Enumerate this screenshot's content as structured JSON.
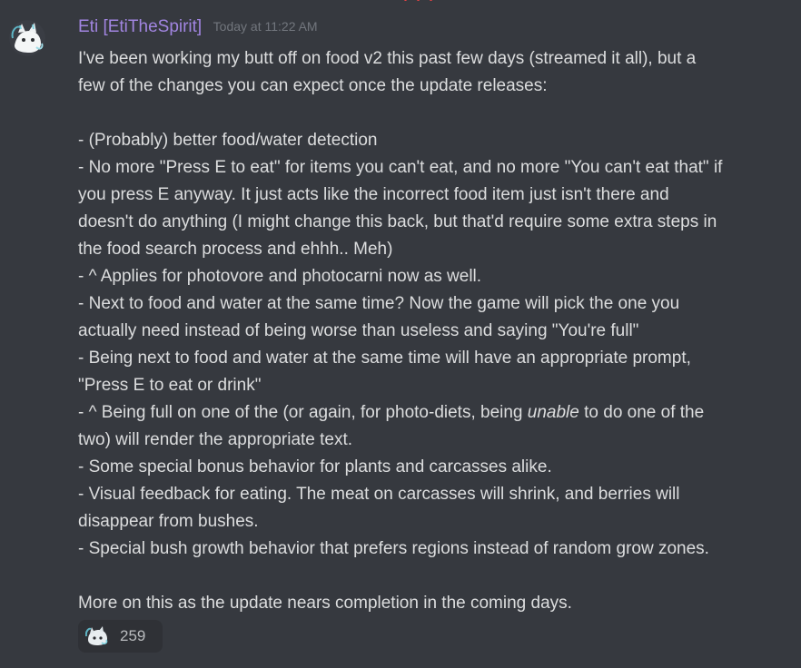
{
  "message": {
    "username": "Eti [EtiTheSpirit]",
    "timestamp": "Today at 11:22 AM",
    "lines": [
      "I've been working my butt off on food v2 this past few days (streamed it all), but a",
      "few of the changes you can expect once the update releases:",
      "",
      "- (Probably) better food/water detection",
      "- No more \"Press E to eat\" for items you can't eat, and no more \"You can't eat that\" if",
      "you press E anyway. It just acts like the incorrect food item just isn't there and",
      "doesn't do anything (I might change this back, but that'd require some extra steps in",
      "the food search process and ehhh.. Meh)",
      "- ^ Applies for photovore and photocarni now as well.",
      "- Next to food and water at the same time? Now the game will pick the one you",
      "actually need instead of being worse than useless and saying \"You're full\"",
      "- Being next to food and water at the same time will have an appropriate prompt,",
      "\"Press E to eat or drink\"",
      "- ^ Being full on one of the (or again, for photo-diets, being ",
      "unable",
      " to do one of the",
      "two) will render the appropriate text.",
      "- Some special bonus behavior for plants and carcasses alike.",
      "- Visual feedback for eating. The meat on carcasses will shrink, and berries will",
      "disappear from bushes.",
      "- Special bush growth behavior that prefers regions instead of random grow zones.",
      "",
      "More on this as the update nears completion in the coming days."
    ]
  },
  "reaction": {
    "icon": "custom-creature-emoji-icon",
    "count": "259"
  },
  "colors": {
    "background": "#36393f",
    "username": "#a185e0",
    "timestamp": "#72767d",
    "text": "#dcddde",
    "reaction_bg": "#2f3136"
  }
}
